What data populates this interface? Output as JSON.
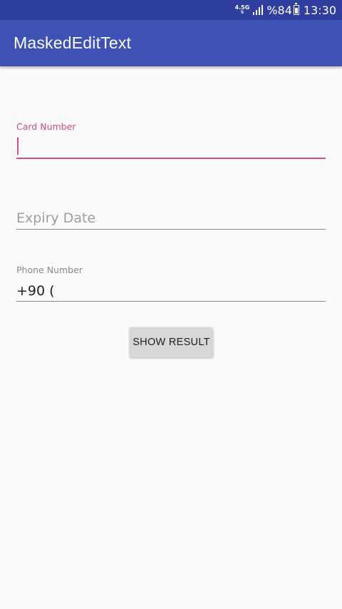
{
  "status_bar": {
    "network_type": "4.5G",
    "battery_percent": "%84",
    "battery_level": 0.84,
    "time": "13:30",
    "icons": [
      "network-type-icon",
      "signal-icon",
      "battery-icon"
    ]
  },
  "app_bar": {
    "title": "MaskedEditText",
    "color": "#3f51b5",
    "status_color": "#303f9f"
  },
  "form": {
    "card_number": {
      "label": "Card Number",
      "value": "",
      "focused": true,
      "accent_color": "#e04783"
    },
    "expiry_date": {
      "placeholder": "Expiry Date",
      "value": ""
    },
    "phone_number": {
      "label": "Phone Number",
      "value": "+90 ("
    }
  },
  "actions": {
    "show_result_label": "SHOW RESULT"
  }
}
